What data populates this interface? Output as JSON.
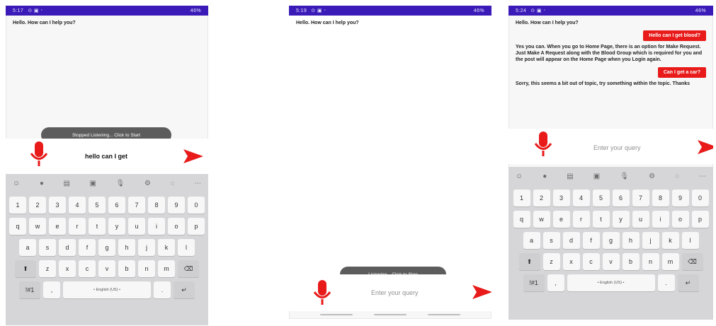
{
  "phone1": {
    "status": {
      "time": "5:17",
      "right": "46%"
    },
    "bot_greeting": "Hello. How can I help you?",
    "toast": "Stopped Listening... Click to Start",
    "query_text": "hello can I get",
    "space_label": "• English (US) •"
  },
  "phone2": {
    "status": {
      "time": "5:19",
      "right": "46%"
    },
    "bot_greeting": "Hello. How can I help you?",
    "toast": "Listening... Click to Stop",
    "query_placeholder": "Enter your query"
  },
  "phone3": {
    "status": {
      "time": "5:24",
      "right": "46%"
    },
    "messages": [
      {
        "from": "bot",
        "text": "Hello. How can I help you?"
      },
      {
        "from": "user",
        "text": "Hello can I get blood?"
      },
      {
        "from": "bot",
        "text": "Yes you can. When you go to Home Page, there is an option for Make Request. Just Make A Request along with the Blood Group which is required for you and the post will appear on the Home Page when you Login again."
      },
      {
        "from": "user",
        "text": "Can I get a car?"
      },
      {
        "from": "bot",
        "text": "Sorry, this seems a bit out of topic, try something within the topic. Thanks"
      }
    ],
    "query_placeholder": "Enter your query",
    "space_label": "• English (US) •"
  },
  "keyboard": {
    "numbers": [
      "1",
      "2",
      "3",
      "4",
      "5",
      "6",
      "7",
      "8",
      "9",
      "0"
    ],
    "row1": [
      "q",
      "w",
      "e",
      "r",
      "t",
      "y",
      "u",
      "i",
      "o",
      "p"
    ],
    "row2": [
      "a",
      "s",
      "d",
      "f",
      "g",
      "h",
      "j",
      "k",
      "l"
    ],
    "row3": [
      "z",
      "x",
      "c",
      "v",
      "b",
      "n",
      "m"
    ],
    "sym_key": "!#1",
    "comma": ",",
    "period": "."
  },
  "colors": {
    "status_bar": "#3a1bb8",
    "accent_red": "#e81a1a",
    "toast": "#5c5c5c"
  }
}
